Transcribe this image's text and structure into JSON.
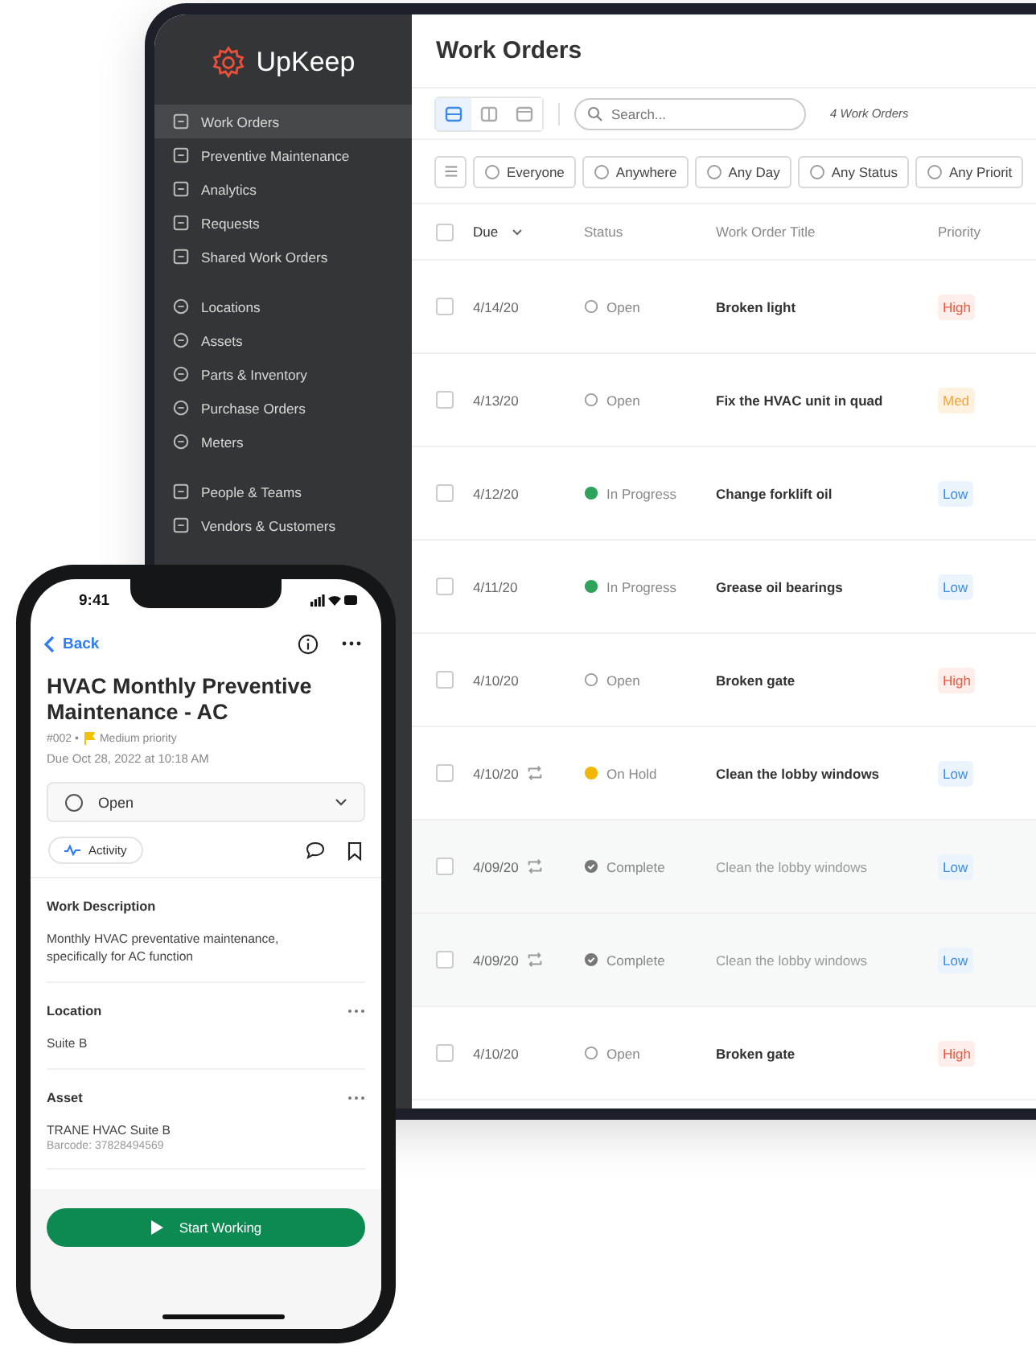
{
  "tablet": {
    "sidebar": {
      "logo": "UpKeep",
      "groups": [
        [
          {
            "label": "Work Orders",
            "selected": true
          },
          {
            "label": "Preventive Maintenance",
            "selected": false
          },
          {
            "label": "Analytics",
            "selected": false
          },
          {
            "label": "Requests",
            "selected": false
          },
          {
            "label": "Shared Work Orders",
            "selected": false
          }
        ],
        [
          {
            "label": "Locations",
            "selected": false
          },
          {
            "label": "Assets",
            "selected": false
          },
          {
            "label": "Parts & Inventory",
            "selected": false
          },
          {
            "label": "Purchase Orders",
            "selected": false
          },
          {
            "label": "Meters",
            "selected": false
          }
        ],
        [
          {
            "label": "People & Teams",
            "selected": false
          },
          {
            "label": "Vendors & Customers",
            "selected": false
          }
        ]
      ]
    },
    "title": "Work Orders",
    "view_toggles": [
      {
        "selected": true
      },
      {
        "selected": false
      },
      {
        "selected": false
      }
    ],
    "search": {
      "placeholder": "Search..."
    },
    "count": "4 Work Orders",
    "filters": [
      "Everyone",
      "Anywhere",
      "Any Day",
      "Any Status",
      "Any Priorit"
    ],
    "table": {
      "all_checked": false,
      "columns": [
        "Due",
        "Status",
        "Work Order Title",
        "Priority"
      ],
      "rows": [
        {
          "checked": false,
          "due": "4/14/20",
          "recurring": false,
          "status": {
            "text": "Open",
            "kind": "open"
          },
          "title": "Broken light",
          "priority": {
            "text": "High",
            "kind": "high"
          }
        },
        {
          "checked": false,
          "due": "4/13/20",
          "recurring": false,
          "status": {
            "text": "Open",
            "kind": "open"
          },
          "title": "Fix the HVAC unit in quad",
          "priority": {
            "text": "Med",
            "kind": "med"
          }
        },
        {
          "checked": false,
          "due": "4/12/20",
          "recurring": false,
          "status": {
            "text": "In Progress",
            "kind": "progress"
          },
          "title": "Change forklift oil",
          "priority": {
            "text": "Low",
            "kind": "low"
          }
        },
        {
          "checked": false,
          "due": "4/11/20",
          "recurring": false,
          "status": {
            "text": "In Progress",
            "kind": "progress"
          },
          "title": "Grease oil bearings",
          "priority": {
            "text": "Low",
            "kind": "low"
          }
        },
        {
          "checked": false,
          "due": "4/10/20",
          "recurring": false,
          "status": {
            "text": "Open",
            "kind": "open"
          },
          "title": "Broken gate",
          "priority": {
            "text": "High",
            "kind": "high"
          }
        },
        {
          "checked": false,
          "due": "4/10/20",
          "recurring": true,
          "status": {
            "text": "On Hold",
            "kind": "hold"
          },
          "title": "Clean the lobby windows",
          "priority": {
            "text": "Low",
            "kind": "low"
          }
        },
        {
          "checked": false,
          "due": "4/09/20",
          "recurring": true,
          "status": {
            "text": "Complete",
            "kind": "complete"
          },
          "title": "Clean the lobby windows",
          "priority": {
            "text": "Low",
            "kind": "low"
          }
        },
        {
          "checked": false,
          "due": "4/09/20",
          "recurring": true,
          "status": {
            "text": "Complete",
            "kind": "complete"
          },
          "title": "Clean the lobby windows",
          "priority": {
            "text": "Low",
            "kind": "low"
          }
        },
        {
          "checked": false,
          "due": "4/10/20",
          "recurring": false,
          "status": {
            "text": "Open",
            "kind": "open"
          },
          "title": "Broken gate",
          "priority": {
            "text": "High",
            "kind": "high"
          }
        }
      ]
    }
  },
  "phone": {
    "time": "9:41",
    "back": "Back",
    "title": "HVAC Monthly Preventive Maintenance - AC",
    "number": "#002 •",
    "priority": "Medium priority",
    "due": "Due Oct 28, 2022 at 10:18 AM",
    "status": "Open",
    "activity": "Activity",
    "sections": [
      {
        "heading": "Work Description",
        "text": "Monthly HVAC preventative maintenance, specifically for AC function",
        "menu": false
      },
      {
        "heading": "Location",
        "text": "Suite B",
        "menu": true
      },
      {
        "heading": "Asset",
        "text": "TRANE HVAC Suite B",
        "subtext": "Barcode: 37828494569",
        "menu": true
      }
    ],
    "button": "Start Working"
  }
}
